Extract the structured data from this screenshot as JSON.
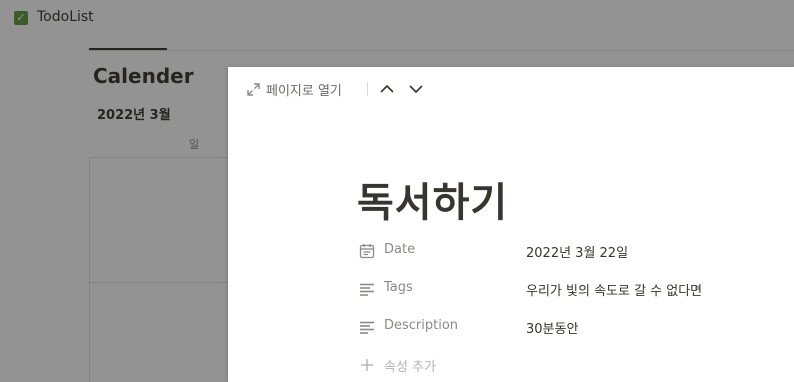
{
  "app": {
    "title": "TodoList",
    "check_icon": "checkbox-checked-icon"
  },
  "calendar": {
    "title": "Calender",
    "month": "2022년 3월",
    "day_header": "일"
  },
  "panel": {
    "toolbar": {
      "open_page_label": "페이지로 열기",
      "open_icon": "expand-diagonal-icon",
      "up_icon": "chevron-up-icon",
      "down_icon": "chevron-down-icon"
    },
    "page_title": "독서하기",
    "properties": [
      {
        "name": "Date",
        "value": "2022년 3월 22일",
        "icon": "calendar-icon"
      },
      {
        "name": "Tags",
        "value": "우리가 빛의 속도로 갈 수 없다면",
        "icon": "text-lines-icon"
      },
      {
        "name": "Description",
        "value": "30분동안",
        "icon": "text-lines-icon"
      }
    ],
    "add_property_label": "속성 추가",
    "add_icon": "plus-icon"
  }
}
